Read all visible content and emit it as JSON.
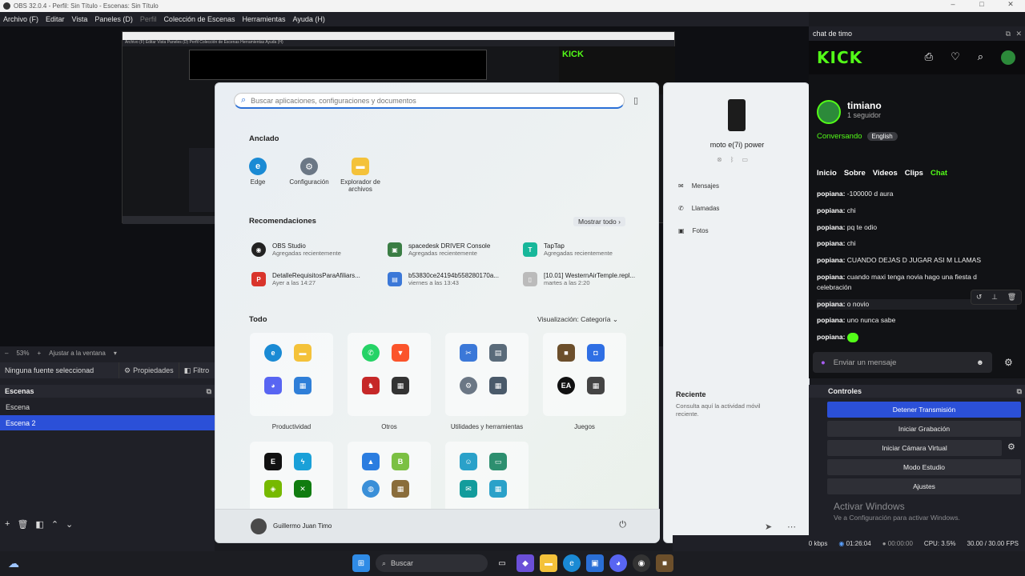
{
  "obs": {
    "title": "OBS 32.0.4 - Perfil: Sin Título - Escenas: Sin Título",
    "menu": [
      "Archivo (F)",
      "Editar",
      "Vista",
      "Paneles (D)",
      "Perfil",
      "Colección de Escenas",
      "Herramientas",
      "Ayuda (H)"
    ],
    "zoom": "53%",
    "fit_label": "Ajustar a la ventana",
    "no_source": "Ninguna fuente seleccionad",
    "properties": "Propiedades",
    "filters": "Filtro",
    "scenes_header": "Escenas",
    "scenes": [
      "Escena",
      "Escena 2"
    ],
    "selected_scene": "Escena 2"
  },
  "nested": {
    "menu": "Archivo (F)  Editar  Vista  Paneles (D)  Perfil  Colección de Escenas  Herramientas  Ayuda (H)",
    "kick": "KICK"
  },
  "start_menu": {
    "search_placeholder": "Buscar aplicaciones, configuraciones y documentos",
    "pinned_title": "Anclado",
    "pinned": [
      {
        "label": "Edge",
        "icon": "edge-icon",
        "color": "#1a8ad4"
      },
      {
        "label": "Configuración",
        "icon": "gear-icon",
        "color": "#6b7785"
      },
      {
        "label": "Explorador de archivos",
        "icon": "folder-icon",
        "color": "#f4c23a"
      }
    ],
    "recommendations_title": "Recomendaciones",
    "show_all": "Mostrar todo",
    "recommendations": [
      {
        "title": "OBS Studio",
        "sub": "Agregadas recientemente",
        "icon": "obs-icon",
        "color": "#222"
      },
      {
        "title": "spacedesk DRIVER Console",
        "sub": "Agregadas recientemente",
        "icon": "spacedesk-icon",
        "color": "#3a7d44"
      },
      {
        "title": "TapTap",
        "sub": "Agregadas recientemente",
        "icon": "taptap-icon",
        "color": "#17b79a"
      },
      {
        "title": "DetalleRequisitosParaAfiliars...",
        "sub": "Ayer a las 14:27",
        "icon": "pdf-icon",
        "color": "#d9342b"
      },
      {
        "title": "b53830ce24194b558280170a...",
        "sub": "viernes a las 13:43",
        "icon": "image-file-icon",
        "color": "#3b78d8"
      },
      {
        "title": "[10.01] WesternAirTemple.repl...",
        "sub": "martes a las 2:20",
        "icon": "document-icon",
        "color": "#999"
      }
    ],
    "all_title": "Todo",
    "view_mode": "Visualización: Categoría",
    "categories": [
      {
        "label": "Productividad",
        "icons": [
          "edge-icon",
          "folder-icon",
          "discord-icon",
          "apps-icon"
        ],
        "colors": [
          "#1a8ad4",
          "#f4c23a",
          "#5865f2",
          "#2f7fd8"
        ]
      },
      {
        "label": "Otros",
        "icons": [
          "whatsapp-icon",
          "brave-icon",
          "game-icon",
          "apps-icon"
        ],
        "colors": [
          "#25d366",
          "#fb542b",
          "#c62828",
          "#333"
        ]
      },
      {
        "label": "Utilidades y herramientas",
        "icons": [
          "snip-icon",
          "calculator-icon",
          "gear-icon",
          "apps-icon"
        ],
        "colors": [
          "#3b78d8",
          "#5a6b7a",
          "#6b7785",
          "#4a5a6a"
        ]
      },
      {
        "label": "Juegos",
        "icons": [
          "minecraft-icon",
          "roblox-icon",
          "ea-icon",
          "apps-icon"
        ],
        "colors": [
          "#6c4f2b",
          "#2f6fe4",
          "#111",
          "#444"
        ]
      },
      {
        "label": "",
        "icons": [
          "epic-icon",
          "bolt-icon",
          "nvidia-icon",
          "xbox-icon"
        ],
        "colors": [
          "#111",
          "#1aa0d8",
          "#76b900",
          "#107c10"
        ]
      },
      {
        "label": "",
        "icons": [
          "photos-icon",
          "tb-icon",
          "globe-icon",
          "apps-icon"
        ],
        "colors": [
          "#2b7de0",
          "#7bc043",
          "#3a8fd8",
          "#8a6d3b"
        ]
      },
      {
        "label": "",
        "icons": [
          "user-icon",
          "screen-icon",
          "chat-icon",
          "apps-icon"
        ],
        "colors": [
          "#2aa1c9",
          "#2d8f6f",
          "#139c9c",
          "#2aa1c9"
        ]
      }
    ],
    "user": "Guillermo Juan Timo"
  },
  "phone": {
    "name": "moto e(7i) power",
    "items": [
      "Mensajes",
      "Llamadas",
      "Fotos"
    ],
    "recent_title": "Reciente",
    "recent_desc": "Consulta aquí la actividad móvil reciente."
  },
  "chat": {
    "title": "chat de timo",
    "brand": "KICK",
    "channel": "timiano",
    "followers": "1 seguidor",
    "status": "Conversando",
    "lang": "English",
    "tabs": [
      "Inicio",
      "Sobre",
      "Videos",
      "Clips",
      "Chat"
    ],
    "messages": [
      {
        "user": "popiana:",
        "text": "-100000 d aura"
      },
      {
        "user": "popiana:",
        "text": "chi"
      },
      {
        "user": "popiana:",
        "text": "pq te odio"
      },
      {
        "user": "popiana:",
        "text": "chi"
      },
      {
        "user": "popiana:",
        "text": "CUANDO DEJAS D JUGAR ASI M LLAMAS"
      },
      {
        "user": "popiana:",
        "text": "cuando maxi tenga novia hago una fiesta d celebración"
      },
      {
        "user": "popiana:",
        "text": "o novio"
      },
      {
        "user": "popiana:",
        "text": "uno nunca sabe"
      },
      {
        "user": "popiana:",
        "text": ""
      }
    ],
    "input_placeholder": "Enviar un mensaje",
    "accent": "#53fc18"
  },
  "controls": {
    "header": "Controles",
    "buttons": [
      "Detener Transmisión",
      "Iniciar Grabación",
      "Iniciar Cámara Virtual",
      "Modo Estudio",
      "Ajustes"
    ]
  },
  "activation": {
    "title": "Activar Windows",
    "sub": "Ve a Configuración para activar Windows."
  },
  "status": {
    "bitrate": "0 kbps",
    "stream_time": "01:26:04",
    "rec_time": "00:00:00",
    "cpu": "CPU: 3.5%",
    "fps": "30.00 / 30.00 FPS"
  },
  "taskbar": {
    "search": "Buscar"
  }
}
